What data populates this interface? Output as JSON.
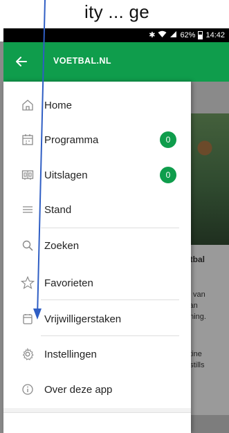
{
  "caption": {
    "text": "ity ... ge"
  },
  "status_bar": {
    "icons": [
      "bluetooth-icon",
      "wifi-icon",
      "signal-icon"
    ],
    "battery": "62%",
    "time": "14:42"
  },
  "toolbar": {
    "title": "VOETBAL.NL"
  },
  "drawer": {
    "items": [
      {
        "label": "Home",
        "icon": "home-icon",
        "badge": ""
      },
      {
        "label": "Programma",
        "icon": "calendar-icon",
        "badge": "0"
      },
      {
        "label": "Uitslagen",
        "icon": "scoreboard-icon",
        "badge": "0"
      },
      {
        "label": "Stand",
        "icon": "list-icon",
        "badge": ""
      },
      {
        "label": "Zoeken",
        "icon": "search-icon",
        "badge": ""
      },
      {
        "label": "Favorieten",
        "icon": "star-icon",
        "badge": ""
      },
      {
        "label": "Vrijwilligerstaken",
        "icon": "clipboard-icon",
        "badge": ""
      },
      {
        "label": "Instellingen",
        "icon": "gear-icon",
        "badge": ""
      },
      {
        "label": "Over deze app",
        "icon": "info-icon",
        "badge": ""
      }
    ]
  },
  "background": {
    "card_title": "etbal",
    "card_lines": [
      "is van",
      "van",
      "ening.",
      "ntine",
      "pstills"
    ]
  },
  "colors": {
    "brand_green": "#0f9d4c",
    "annotation_blue": "#2f5ec4"
  }
}
